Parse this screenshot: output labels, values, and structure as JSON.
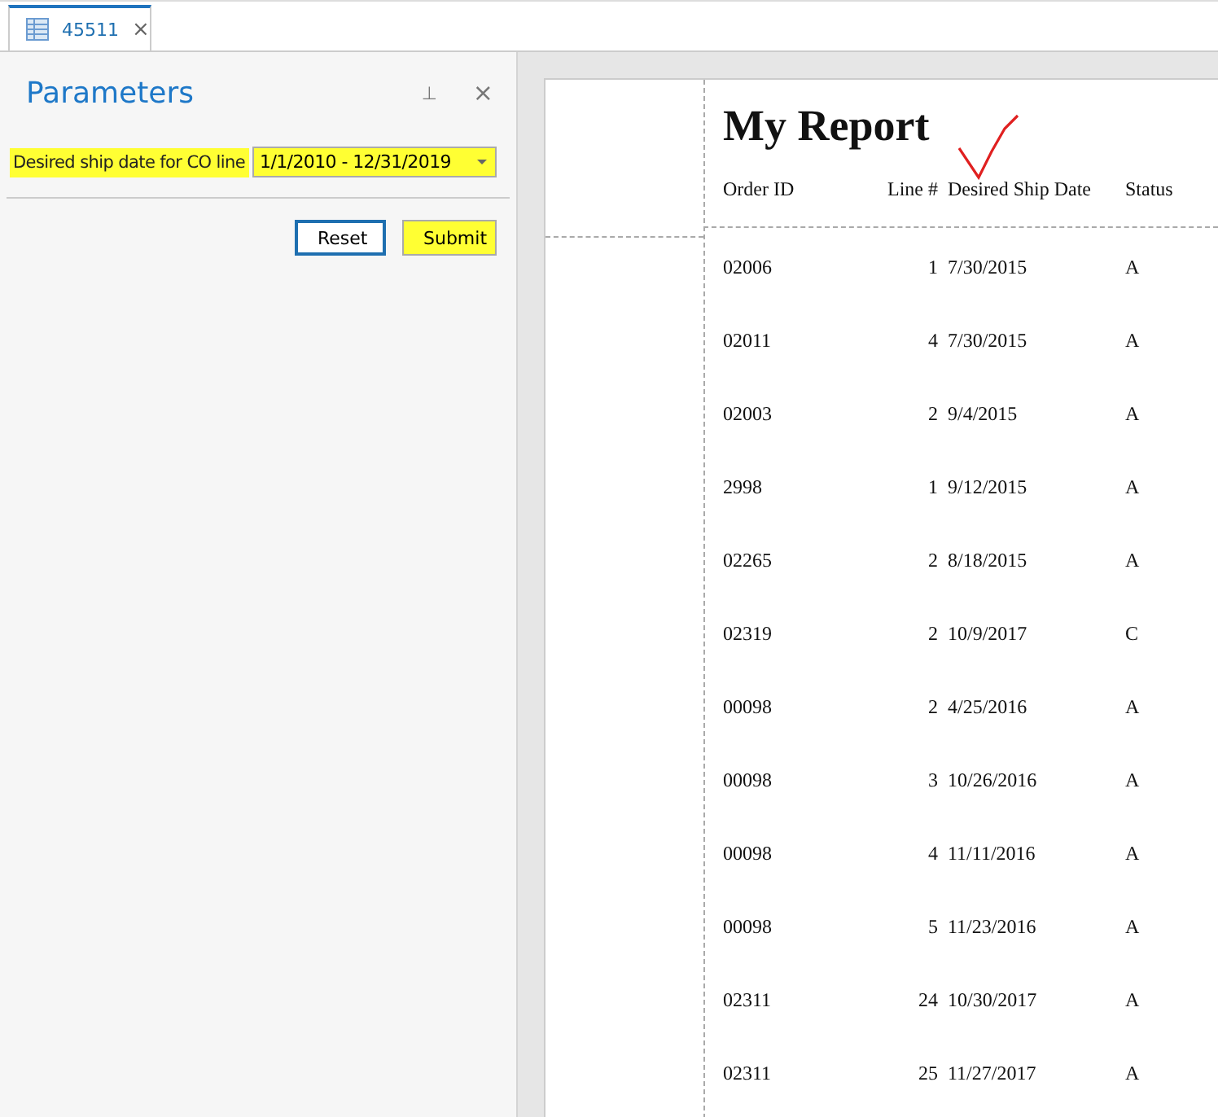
{
  "tab": {
    "label": "45511",
    "close_icon": "×",
    "selected": true
  },
  "parameters_panel": {
    "title": "Parameters",
    "pin_icon": "⊥",
    "close_icon": "×",
    "parameter": {
      "label": "Desired ship date for CO line",
      "value": "1/1/2010 - 12/31/2019",
      "highlighted": true
    },
    "buttons": [
      {
        "label": "Reset",
        "focused": true,
        "highlighted": false
      },
      {
        "label": "Submit",
        "focused": false,
        "highlighted": true
      }
    ]
  },
  "report": {
    "title": "My Report",
    "columns": [
      "Order ID",
      "Line #",
      "Desired Ship Date",
      "Status"
    ],
    "rows": [
      [
        "02006",
        "1",
        "7/30/2015",
        "A"
      ],
      [
        "02011",
        "4",
        "7/30/2015",
        "A"
      ],
      [
        "02003",
        "2",
        "9/4/2015",
        "A"
      ],
      [
        "2998",
        "1",
        "9/12/2015",
        "A"
      ],
      [
        "02265",
        "2",
        "8/18/2015",
        "A"
      ],
      [
        "02319",
        "2",
        "10/9/2017",
        "C"
      ],
      [
        "00098",
        "2",
        "4/25/2016",
        "A"
      ],
      [
        "00098",
        "3",
        "10/26/2016",
        "A"
      ],
      [
        "00098",
        "4",
        "11/11/2016",
        "A"
      ],
      [
        "00098",
        "5",
        "11/23/2016",
        "A"
      ],
      [
        "02311",
        "24",
        "10/30/2017",
        "A"
      ],
      [
        "02311",
        "25",
        "11/27/2017",
        "A"
      ]
    ]
  }
}
